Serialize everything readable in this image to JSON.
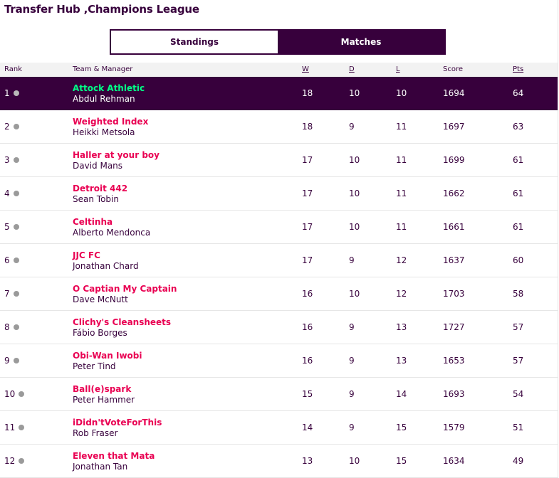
{
  "header": {
    "title": "Transfer Hub ,Champions League"
  },
  "tabs": [
    {
      "label": "Standings",
      "active": false
    },
    {
      "label": "Matches",
      "active": true
    }
  ],
  "table": {
    "columns": {
      "rank": "Rank",
      "team_manager": "Team & Manager",
      "w": "W",
      "d": "D",
      "l": "L",
      "score": "Score",
      "pts": "Pts"
    },
    "rows": [
      {
        "rank": "1",
        "team": "Attock Athletic",
        "manager": "Abdul Rehman",
        "w": "18",
        "d": "10",
        "l": "10",
        "score": "1694",
        "pts": "64"
      },
      {
        "rank": "2",
        "team": "Weighted Index",
        "manager": "Heikki Metsola",
        "w": "18",
        "d": "9",
        "l": "11",
        "score": "1697",
        "pts": "63"
      },
      {
        "rank": "3",
        "team": "Haller at your boy",
        "manager": "David Mans",
        "w": "17",
        "d": "10",
        "l": "11",
        "score": "1699",
        "pts": "61"
      },
      {
        "rank": "4",
        "team": "Detroit 442",
        "manager": "Sean Tobin",
        "w": "17",
        "d": "10",
        "l": "11",
        "score": "1662",
        "pts": "61"
      },
      {
        "rank": "5",
        "team": "Celtinha",
        "manager": "Alberto Mendonca",
        "w": "17",
        "d": "10",
        "l": "11",
        "score": "1661",
        "pts": "61"
      },
      {
        "rank": "6",
        "team": "JJC FC",
        "manager": "Jonathan Chard",
        "w": "17",
        "d": "9",
        "l": "12",
        "score": "1637",
        "pts": "60"
      },
      {
        "rank": "7",
        "team": "O Captian My Captain",
        "manager": "Dave McNutt",
        "w": "16",
        "d": "10",
        "l": "12",
        "score": "1703",
        "pts": "58"
      },
      {
        "rank": "8",
        "team": "Clichy's Cleansheets",
        "manager": "Fábio Borges",
        "w": "16",
        "d": "9",
        "l": "13",
        "score": "1727",
        "pts": "57"
      },
      {
        "rank": "9",
        "team": "Obi-Wan Iwobi",
        "manager": "Peter Tind",
        "w": "16",
        "d": "9",
        "l": "13",
        "score": "1653",
        "pts": "57"
      },
      {
        "rank": "10",
        "team": "Ball(e)spark",
        "manager": "Peter Hammer",
        "w": "15",
        "d": "9",
        "l": "14",
        "score": "1693",
        "pts": "54"
      },
      {
        "rank": "11",
        "team": "iDidn'tVoteForThis",
        "manager": "Rob Fraser",
        "w": "14",
        "d": "9",
        "l": "15",
        "score": "1579",
        "pts": "51"
      },
      {
        "rank": "12",
        "team": "Eleven that Mata",
        "manager": "Jonathan Tan",
        "w": "13",
        "d": "10",
        "l": "15",
        "score": "1634",
        "pts": "49"
      }
    ]
  },
  "colors": {
    "primary": "#37003c",
    "team_link": "#e90052",
    "highlight_team": "#00ff87",
    "header_bg": "#f2f2f2",
    "movement_dot": "#9a9a9a"
  },
  "icons": {
    "movement": "no-change-dot-icon"
  }
}
